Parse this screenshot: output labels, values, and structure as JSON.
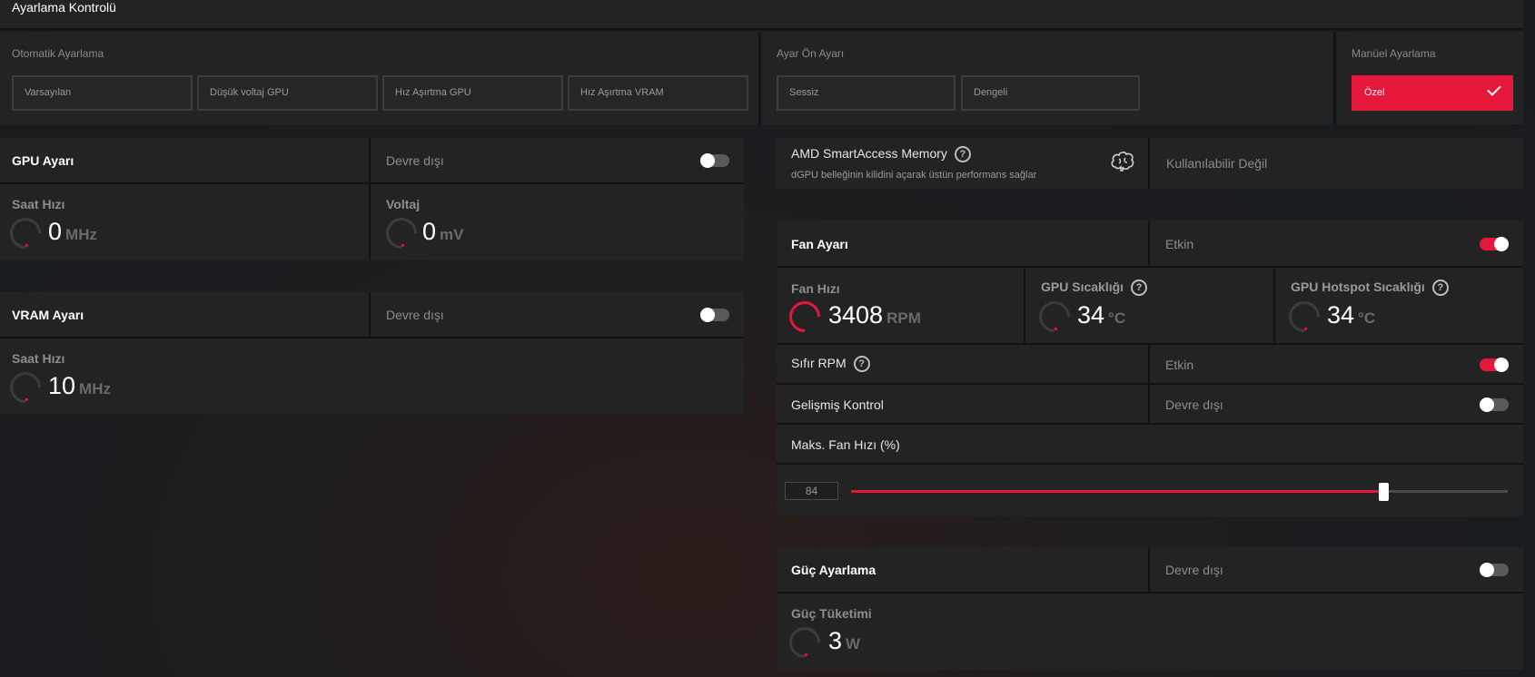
{
  "header": {
    "title": "Ayarlama Kontrolü"
  },
  "auto_tuning": {
    "label": "Otomatik Ayarlama",
    "buttons": [
      "Varsayılan",
      "Düşük voltaj GPU",
      "Hız Aşırtma GPU",
      "Hız Aşırtma VRAM"
    ]
  },
  "preset": {
    "label": "Ayar Ön Ayarı",
    "buttons": [
      "Sessiz",
      "Dengeli"
    ]
  },
  "manual": {
    "label": "Manüel Ayarlama",
    "button": "Özel"
  },
  "gpu_tuning": {
    "title": "GPU Ayarı",
    "status": "Devre dışı",
    "enabled": false,
    "clock": {
      "label": "Saat Hızı",
      "value": "0",
      "unit": "MHz"
    },
    "voltage": {
      "label": "Voltaj",
      "value": "0",
      "unit": "mV"
    }
  },
  "vram_tuning": {
    "title": "VRAM Ayarı",
    "status": "Devre dışı",
    "enabled": false,
    "clock": {
      "label": "Saat Hızı",
      "value": "10",
      "unit": "MHz"
    }
  },
  "smart_access": {
    "title": "AMD SmartAccess Memory",
    "help": "?",
    "description": "dGPU belleğinin kilidini açarak üstün performans sağlar",
    "status": "Kullanılabilir Değil",
    "icon": "brain-icon"
  },
  "fan_tuning": {
    "title": "Fan Ayarı",
    "status": "Etkin",
    "enabled": true,
    "fan_speed": {
      "label": "Fan Hızı",
      "value": "3408",
      "unit": "RPM"
    },
    "gpu_temp": {
      "label": "GPU Sıcaklığı",
      "value": "34",
      "unit": "°C"
    },
    "hotspot_temp": {
      "label": "GPU Hotspot Sıcaklığı",
      "value": "34",
      "unit": "°C"
    },
    "zero_rpm": {
      "label": "Sıfır RPM",
      "status": "Etkin",
      "enabled": true
    },
    "advanced": {
      "label": "Gelişmiş Kontrol",
      "status": "Devre dışı",
      "enabled": false
    },
    "max_fan": {
      "label": "Maks. Fan Hızı (%)",
      "value": "84",
      "fraction": 0.81
    }
  },
  "power_tuning": {
    "title": "Güç Ayarlama",
    "status": "Devre dışı",
    "enabled": false,
    "consumption": {
      "label": "Güç Tüketimi",
      "value": "3",
      "unit": "W"
    }
  },
  "colors": {
    "accent": "#e5173a",
    "panel": "#232324",
    "border": "#121214"
  }
}
